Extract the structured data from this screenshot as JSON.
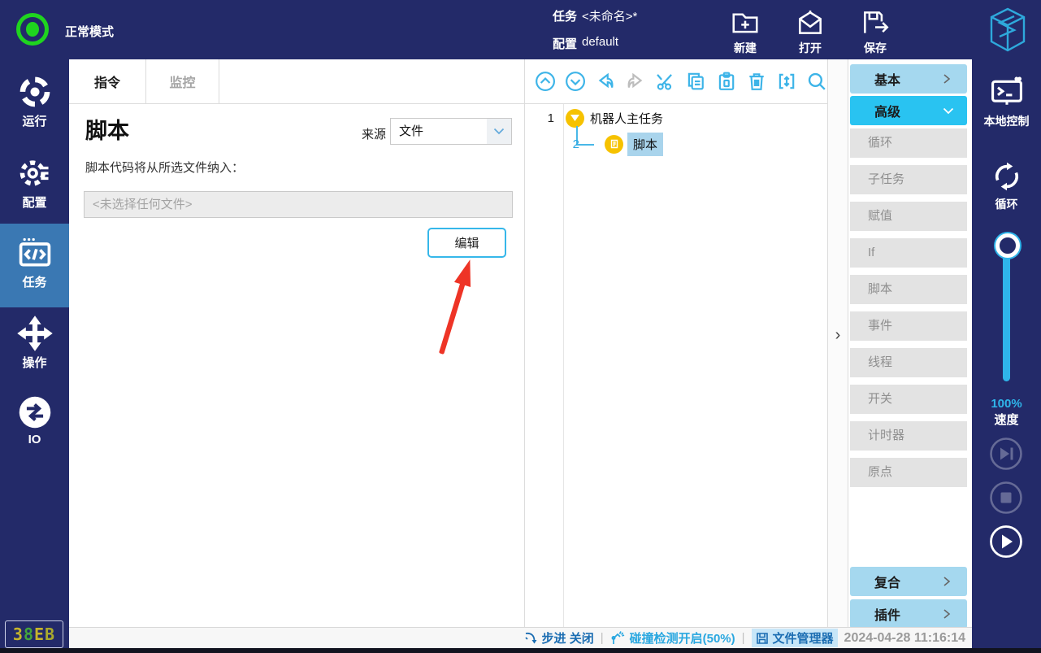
{
  "top_bar": {
    "mode": "正常模式",
    "task_label": "任务",
    "task_value": "<未命名>*",
    "config_label": "配置",
    "config_value": "default",
    "new_label": "新建",
    "open_label": "打开",
    "save_label": "保存",
    "icons": [
      "status-light",
      "new-icon",
      "open-icon",
      "save-icon",
      "brand-logo"
    ]
  },
  "left_sidebar": {
    "run": "运行",
    "config": "配置",
    "task": "任务",
    "operate": "操作",
    "io": "IO",
    "active_item": "任务",
    "badge": {
      "c1": "3",
      "c2": "8",
      "c3": "E",
      "c4": "B"
    }
  },
  "main_panel": {
    "tab_instruction": "指令",
    "tab_monitor": "监控",
    "title": "脚本",
    "source_label": "来源",
    "source_value": "文件",
    "hint": "脚本代码将从所选文件纳入：",
    "file_value": "<未选择任何文件>",
    "edit_button": "编辑"
  },
  "tree_panel": {
    "toolbar_icons": [
      "move-up",
      "move-down",
      "undo",
      "redo",
      "cut",
      "copy",
      "paste",
      "delete",
      "insert",
      "search"
    ],
    "rows": [
      {
        "num": "1",
        "label": "机器人主任务",
        "selected": false
      },
      {
        "num": "2",
        "label": "脚本",
        "selected": true
      }
    ]
  },
  "instruction_panel": {
    "basic": "基本",
    "advanced": "高级",
    "advanced_items": [
      "循环",
      "子任务",
      "赋值",
      "If",
      "脚本",
      "事件",
      "线程",
      "开关",
      "计时器",
      "原点"
    ],
    "composite": "复合",
    "plugin": "插件"
  },
  "right_sidebar": {
    "local_control": "本地控制",
    "loop": "循环",
    "speed_value": "100%",
    "speed_label": "速度",
    "playback_icons": [
      "step-button",
      "stop-button",
      "play-button"
    ]
  },
  "status_bar": {
    "step": "步进 关闭",
    "collision": "碰撞检测开启(50%)",
    "file_manager": "文件管理器",
    "timestamp": "2024-04-28 11:16:14"
  },
  "colors": {
    "navy": "#232a69",
    "accent_cyan": "#29abe2",
    "active_nav_blue": "#3a78b3",
    "bright_cyan": "#29c3f1",
    "light_blue": "#a5d8ef",
    "node_yellow": "#f6c200",
    "selection_blue": "#a9d4ec",
    "status_green": "#1fd41f",
    "arrow_red": "#ee3426"
  }
}
